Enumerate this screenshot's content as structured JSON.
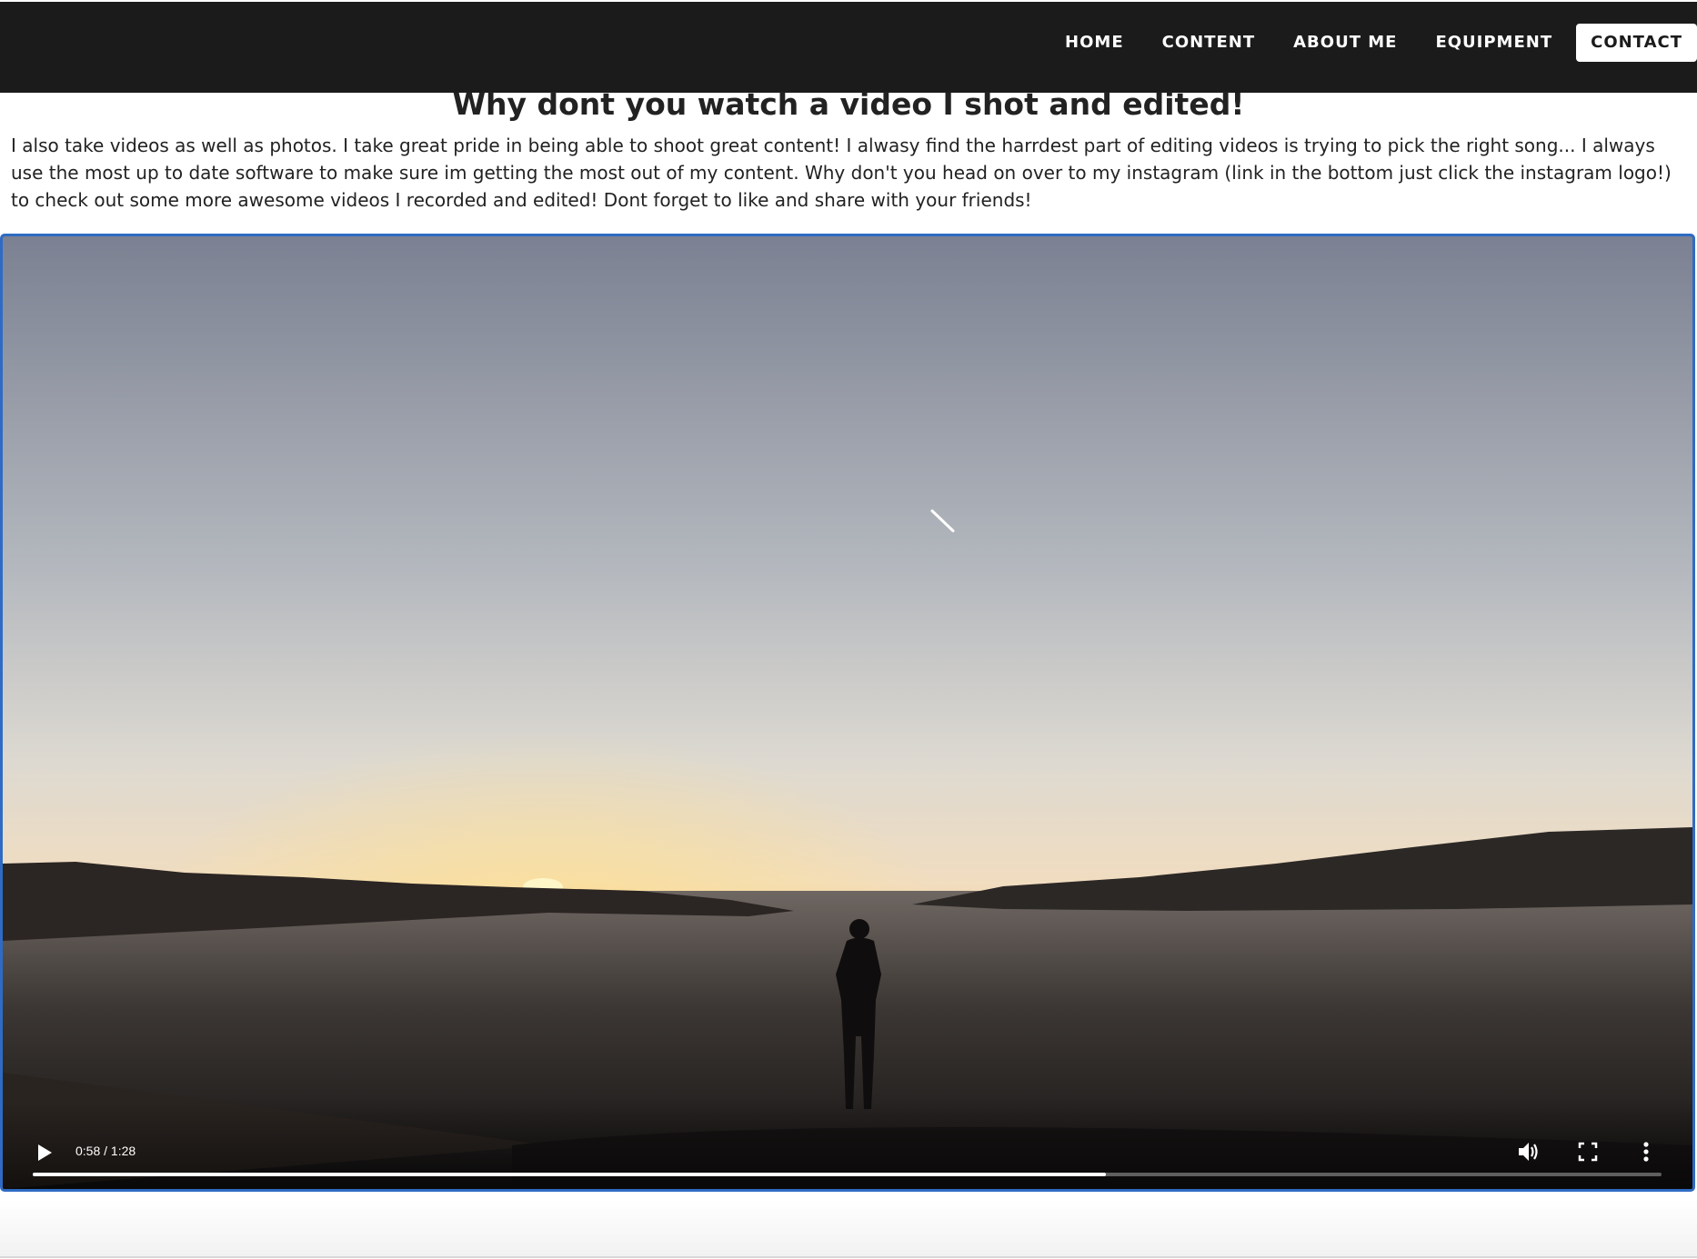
{
  "nav": {
    "items": [
      {
        "label": "HOME"
      },
      {
        "label": "CONTENT"
      },
      {
        "label": "ABOUT ME"
      },
      {
        "label": "EQUIPMENT"
      },
      {
        "label": "CONTACT"
      }
    ],
    "active": "CONTACT"
  },
  "main": {
    "title": "Why dont you watch a video I shot and edited!",
    "paragraph": "I also take videos as well as photos. I take great pride in being able to shoot great content! I alwasy find the harrdest part of editing videos is trying to pick the right song... I always use the most up to date software to make sure im getting the most out of my content. Why don't you head on over to my instagram (link in the bottom just click the instagram logo!) to check out some more awesome videos I recorded and edited! Dont forget to like and share with your friends!"
  },
  "video": {
    "time": "0:58 / 1:28",
    "progress_fraction": 0.659,
    "icons": [
      "play-icon",
      "volume-icon",
      "fullscreen-icon",
      "more-options-icon"
    ]
  },
  "colors": {
    "navbar": "#1b1b1b",
    "video_border": "#2f6bc4"
  }
}
